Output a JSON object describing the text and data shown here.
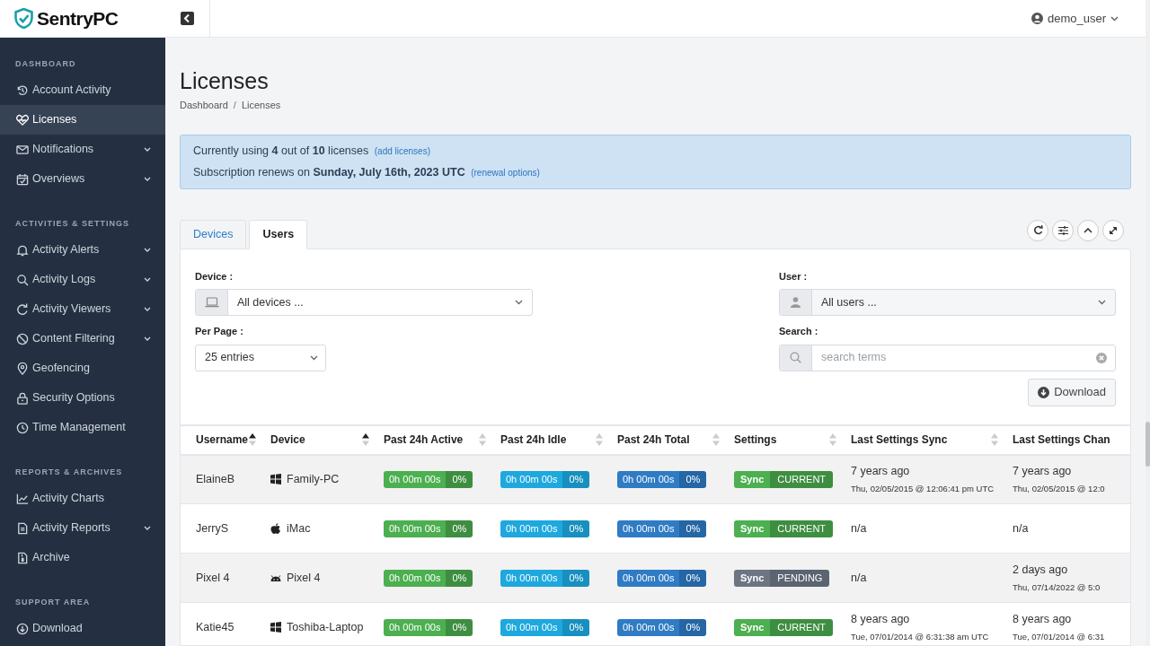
{
  "brand": {
    "name": "SentryPC"
  },
  "user_menu": {
    "username": "demo_user"
  },
  "sidebar": {
    "sections": [
      {
        "heading": "DASHBOARD",
        "items": [
          {
            "label": "Account Activity",
            "selected": false,
            "has_submenu": false
          },
          {
            "label": "Licenses",
            "selected": true,
            "has_submenu": false
          },
          {
            "label": "Notifications",
            "selected": false,
            "has_submenu": true
          },
          {
            "label": "Overviews",
            "selected": false,
            "has_submenu": true
          }
        ]
      },
      {
        "heading": "ACTIVITIES & SETTINGS",
        "items": [
          {
            "label": "Activity Alerts",
            "selected": false,
            "has_submenu": true
          },
          {
            "label": "Activity Logs",
            "selected": false,
            "has_submenu": true
          },
          {
            "label": "Activity Viewers",
            "selected": false,
            "has_submenu": true
          },
          {
            "label": "Content Filtering",
            "selected": false,
            "has_submenu": true
          },
          {
            "label": "Geofencing",
            "selected": false,
            "has_submenu": false
          },
          {
            "label": "Security Options",
            "selected": false,
            "has_submenu": false
          },
          {
            "label": "Time Management",
            "selected": false,
            "has_submenu": false
          }
        ]
      },
      {
        "heading": "REPORTS & ARCHIVES",
        "items": [
          {
            "label": "Activity Charts",
            "selected": false,
            "has_submenu": false
          },
          {
            "label": "Activity Reports",
            "selected": false,
            "has_submenu": true
          },
          {
            "label": "Archive",
            "selected": false,
            "has_submenu": false
          }
        ]
      },
      {
        "heading": "SUPPORT AREA",
        "items": [
          {
            "label": "Download",
            "selected": false,
            "has_submenu": false
          }
        ]
      }
    ]
  },
  "page": {
    "title": "Licenses",
    "breadcrumb": [
      "Dashboard",
      "Licenses"
    ],
    "breadcrumb_separator": "/"
  },
  "alert": {
    "usage": "Currently using **4** out of **10** licenses",
    "usage_link": "(add licenses)",
    "renewal": "Subscription renews on **Sunday, July 16th, 2023 UTC**",
    "renewal_link": "(renewal options)"
  },
  "tabs": [
    {
      "label": "Devices",
      "selected": false
    },
    {
      "label": "Users",
      "selected": true
    }
  ],
  "filters": {
    "device_label": "Device :",
    "device_value": "All devices ...",
    "per_page_label": "Per Page :",
    "per_page_value": "25 entries",
    "user_label": "User :",
    "user_value": "All users ...",
    "search_label": "Search :",
    "search_placeholder": "search terms",
    "download_button": "Download"
  },
  "table": {
    "columns": [
      {
        "label": "Username",
        "sorted_ascending": true
      },
      {
        "label": "Device",
        "sorted_ascending": true
      },
      {
        "label": "Past 24h Active",
        "sorted_ascending": false
      },
      {
        "label": "Past 24h Idle",
        "sorted_ascending": false
      },
      {
        "label": "Past 24h Total",
        "sorted_ascending": false
      },
      {
        "label": "Settings",
        "sorted_ascending": false
      },
      {
        "label": "Last Settings Sync",
        "sorted_ascending": false
      },
      {
        "label": "Last Settings Chan"
      }
    ],
    "rows": [
      {
        "username": "ElaineB",
        "device": {
          "kind": "windows",
          "name": "Family-PC"
        },
        "active": {
          "time": "0h 00m 00s",
          "percent": "0%"
        },
        "idle": {
          "time": "0h 00m 00s",
          "percent": "0%"
        },
        "total": {
          "time": "0h 00m 00s",
          "percent": "0%"
        },
        "settings": {
          "label": "Sync",
          "status": "CURRENT",
          "pending": false
        },
        "last_sync": {
          "relative": "7 years ago",
          "date": "Thu, 02/05/2015 @ 12:06:41 pm UTC"
        },
        "last_change": {
          "relative": "7 years ago",
          "date": "Thu, 02/05/2015 @ 12:0"
        }
      },
      {
        "username": "JerryS",
        "device": {
          "kind": "apple",
          "name": "iMac"
        },
        "active": {
          "time": "0h 00m 00s",
          "percent": "0%"
        },
        "idle": {
          "time": "0h 00m 00s",
          "percent": "0%"
        },
        "total": {
          "time": "0h 00m 00s",
          "percent": "0%"
        },
        "settings": {
          "label": "Sync",
          "status": "CURRENT",
          "pending": false
        },
        "last_sync": {
          "relative": "n/a"
        },
        "last_change": {
          "relative": "n/a"
        }
      },
      {
        "username": "Pixel 4",
        "device": {
          "kind": "android",
          "name": "Pixel 4"
        },
        "active": {
          "time": "0h 00m 00s",
          "percent": "0%"
        },
        "idle": {
          "time": "0h 00m 00s",
          "percent": "0%"
        },
        "total": {
          "time": "0h 00m 00s",
          "percent": "0%"
        },
        "settings": {
          "label": "Sync",
          "status": "PENDING",
          "pending": true
        },
        "last_sync": {
          "relative": "n/a"
        },
        "last_change": {
          "relative": "2 days ago",
          "date": "Thu, 07/14/2022 @ 5:0"
        }
      },
      {
        "username": "Katie45",
        "device": {
          "kind": "windows",
          "name": "Toshiba-Laptop"
        },
        "active": {
          "time": "0h 00m 00s",
          "percent": "0%"
        },
        "idle": {
          "time": "0h 00m 00s",
          "percent": "0%"
        },
        "total": {
          "time": "0h 00m 00s",
          "percent": "0%"
        },
        "settings": {
          "label": "Sync",
          "status": "CURRENT",
          "pending": false
        },
        "last_sync": {
          "relative": "8 years ago",
          "date": "Tue, 07/01/2014 @ 6:31:38 am UTC"
        },
        "last_change": {
          "relative": "8 years ago",
          "date": "Tue, 07/01/2014 @ 6:31"
        }
      }
    ]
  }
}
